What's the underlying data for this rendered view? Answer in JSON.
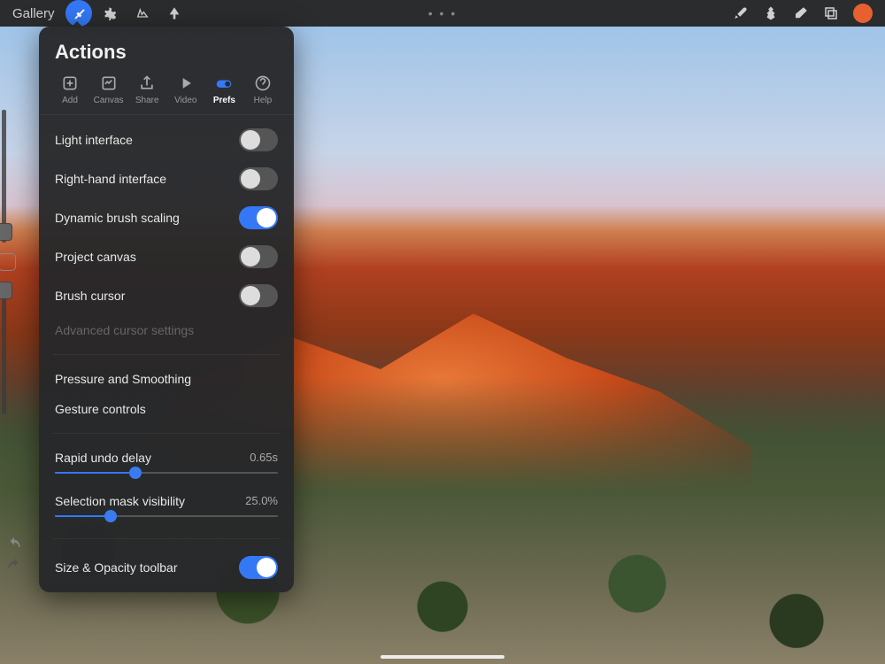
{
  "topbar": {
    "gallery_label": "Gallery",
    "ellipsis": "• • •",
    "color_swatch": "#e86030"
  },
  "panel": {
    "title": "Actions",
    "tabs": [
      {
        "label": "Add"
      },
      {
        "label": "Canvas"
      },
      {
        "label": "Share"
      },
      {
        "label": "Video"
      },
      {
        "label": "Prefs"
      },
      {
        "label": "Help"
      }
    ],
    "prefs": {
      "light_interface": {
        "label": "Light interface",
        "on": false
      },
      "right_hand": {
        "label": "Right-hand interface",
        "on": false
      },
      "dynamic_brush": {
        "label": "Dynamic brush scaling",
        "on": true
      },
      "project_canvas": {
        "label": "Project canvas",
        "on": false
      },
      "brush_cursor": {
        "label": "Brush cursor",
        "on": false
      },
      "advanced_cursor": {
        "label": "Advanced cursor settings"
      },
      "pressure": {
        "label": "Pressure and Smoothing"
      },
      "gesture": {
        "label": "Gesture controls"
      },
      "rapid_undo": {
        "label": "Rapid undo delay",
        "value": "0.65s",
        "pct": 36
      },
      "selection_mask": {
        "label": "Selection mask visibility",
        "value": "25.0%",
        "pct": 25
      },
      "size_opacity": {
        "label": "Size & Opacity toolbar",
        "on": true
      }
    }
  },
  "sidebar": {
    "brush_size_pos": 85,
    "opacity_pos": 0
  }
}
